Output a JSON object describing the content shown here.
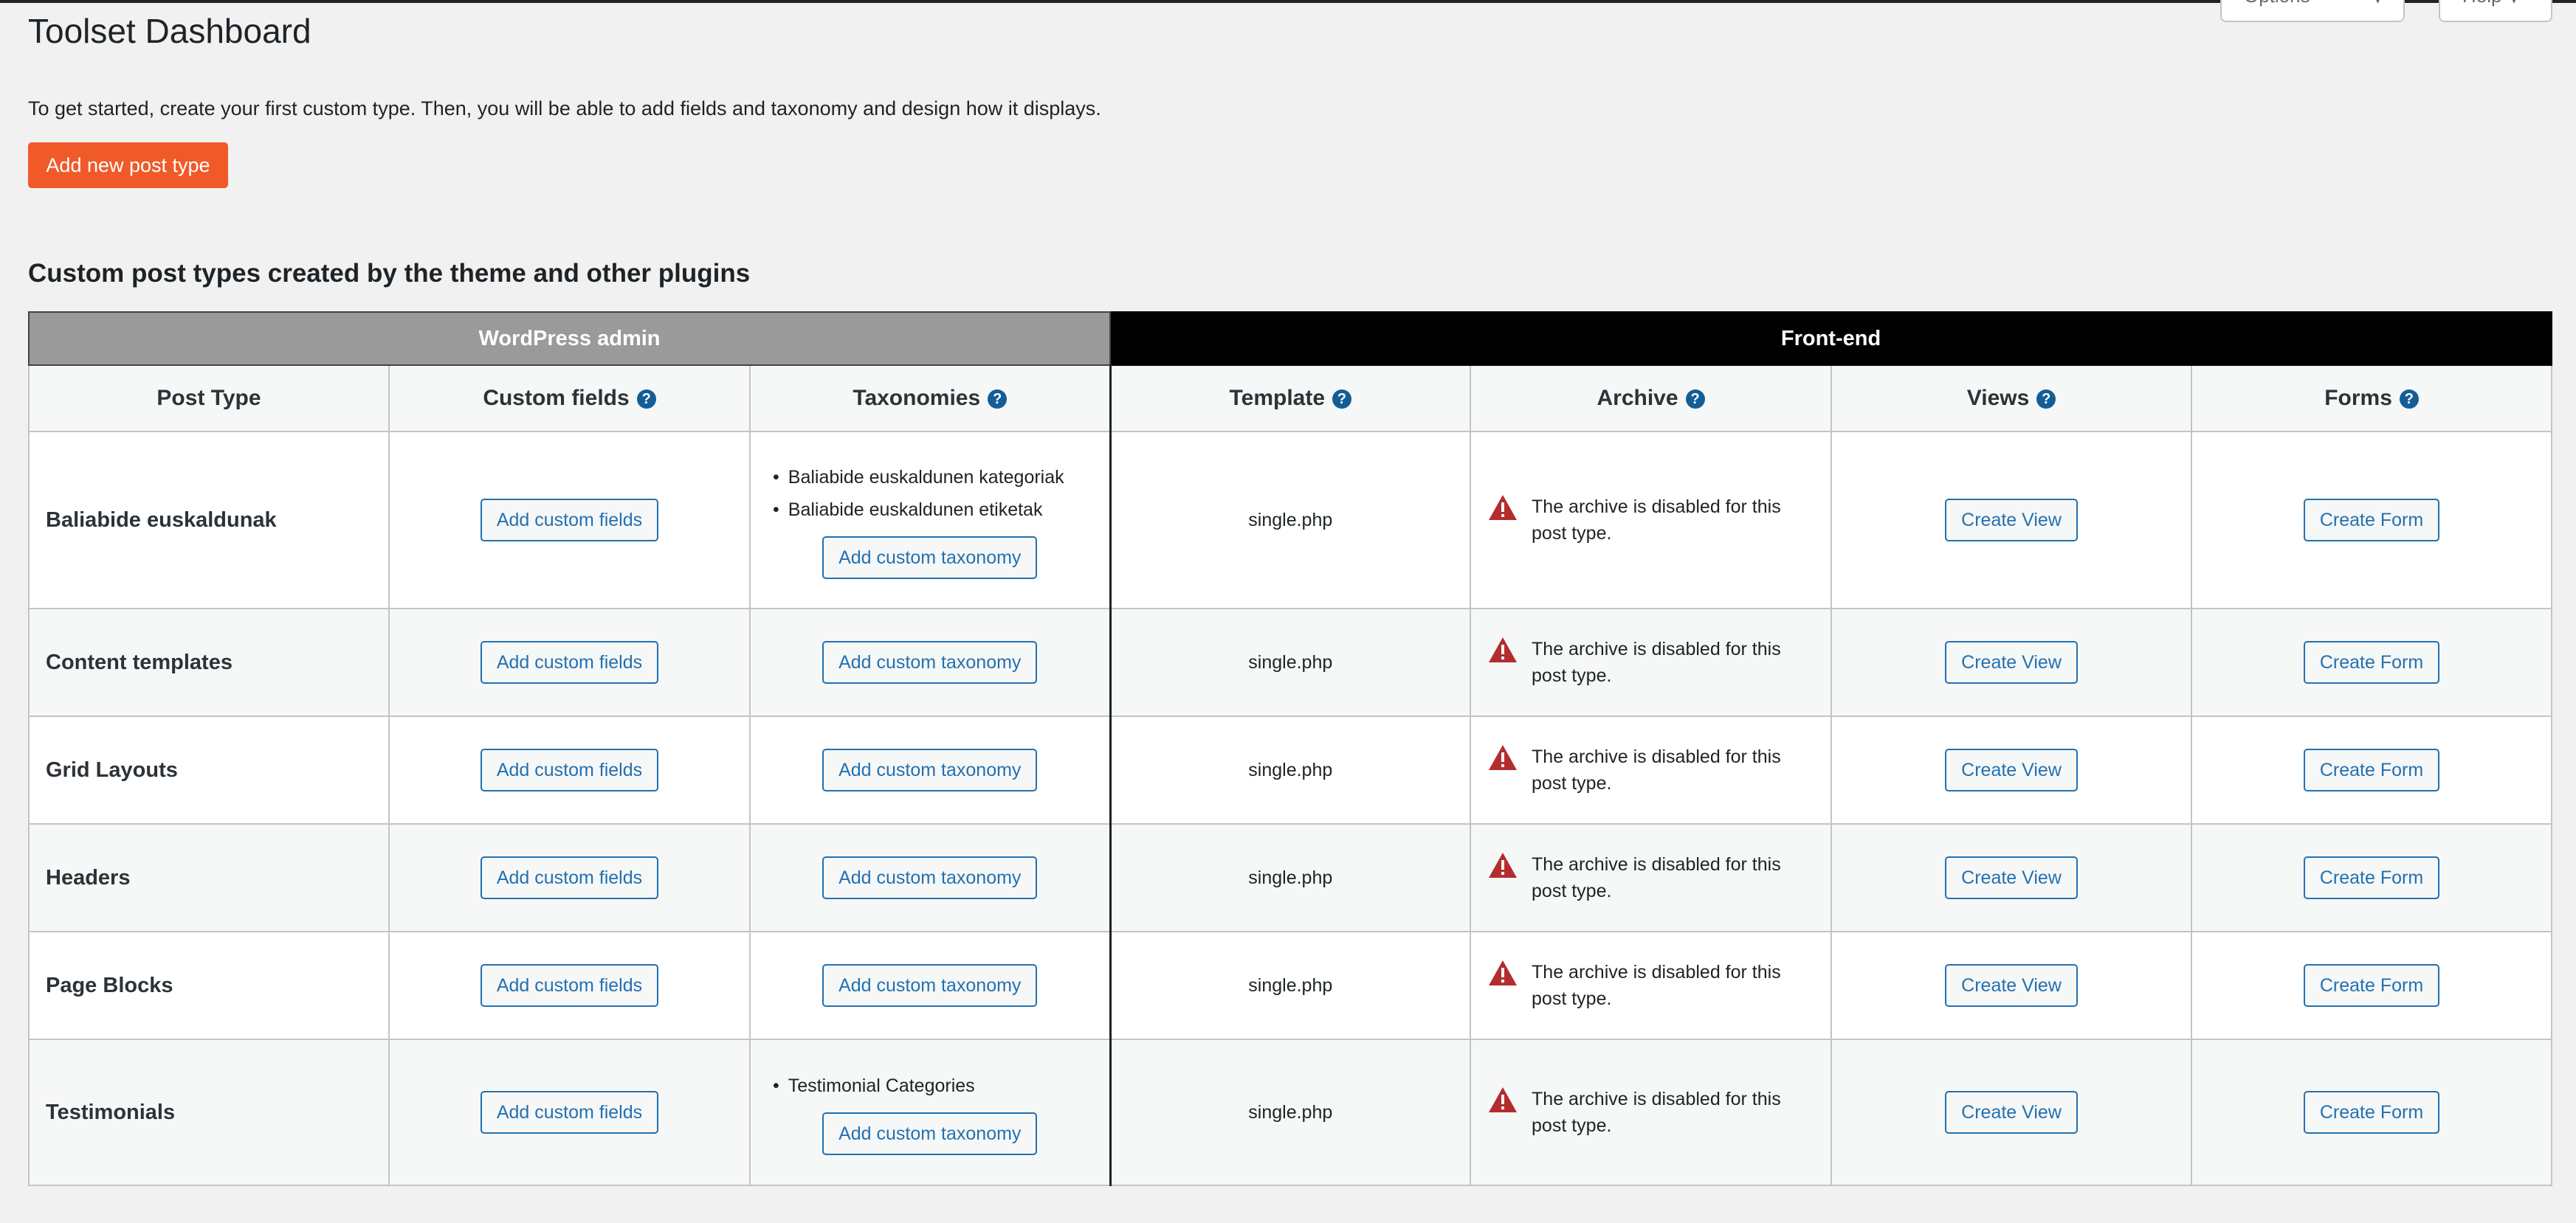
{
  "page": {
    "title": "Toolset Dashboard",
    "screen_options_label": "Screen Options",
    "help_label": "Help",
    "intro": "To get started, create your first custom type. Then, you will be able to add fields and taxonomy and design how it displays.",
    "add_post_type_label": "Add new post type",
    "section_heading": "Custom post types created by the theme and other plugins"
  },
  "table": {
    "group_admin": "WordPress admin",
    "group_front": "Front-end",
    "columns": {
      "post_type": "Post Type",
      "custom_fields": "Custom fields",
      "taxonomies": "Taxonomies",
      "template": "Template",
      "archive": "Archive",
      "views": "Views",
      "forms": "Forms"
    },
    "help_glyph": "?",
    "add_fields_label": "Add custom fields",
    "add_taxonomy_label": "Add custom taxonomy",
    "create_view_label": "Create View",
    "create_form_label": "Create Form",
    "archive_disabled_text": "The archive is disabled for this post type.",
    "rows": [
      {
        "name": "Baliabide euskaldunak",
        "taxonomies": [
          "Baliabide euskaldunen kategoriak",
          "Baliabide euskaldunen etiketak"
        ],
        "template": "single.php"
      },
      {
        "name": "Content templates",
        "taxonomies": [],
        "template": "single.php"
      },
      {
        "name": "Grid Layouts",
        "taxonomies": [],
        "template": "single.php"
      },
      {
        "name": "Headers",
        "taxonomies": [],
        "template": "single.php"
      },
      {
        "name": "Page Blocks",
        "taxonomies": [],
        "template": "single.php"
      },
      {
        "name": "Testimonials",
        "taxonomies": [
          "Testimonial Categories"
        ],
        "template": "single.php"
      }
    ]
  },
  "colors": {
    "primary_button": "#f05a28",
    "link_blue": "#2271b1",
    "help_icon": "#135e96",
    "warning_icon": "#b32d2e",
    "admin_header": "#9a9a9a",
    "front_header": "#000000"
  },
  "icons": {
    "help": "question-circle-icon",
    "warning": "warning-triangle-icon",
    "dropdown": "chevron-down-icon"
  }
}
